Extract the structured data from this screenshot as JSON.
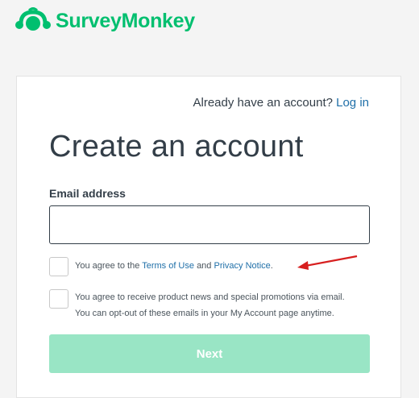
{
  "brand": {
    "name": "SurveyMonkey",
    "color": "#00bf6f"
  },
  "login_prompt": {
    "text": "Already have an account?",
    "link": "Log in"
  },
  "form": {
    "title": "Create an account",
    "email_label": "Email address",
    "email_value": "",
    "email_placeholder": "",
    "terms": {
      "prefix": "You agree to the",
      "terms_link": "Terms of Use",
      "and": "and",
      "privacy_link": "Privacy Notice",
      "suffix": ".",
      "checked": false
    },
    "promotions": {
      "line1": "You agree to receive product news and special promotions via email.",
      "line2": "You can opt-out of these emails in your My Account page anytime.",
      "checked": false
    },
    "next_label": "Next"
  },
  "colors": {
    "link": "#1f6fa8",
    "button_disabled": "#99e5c5",
    "annotation_arrow": "#d71f1f"
  }
}
